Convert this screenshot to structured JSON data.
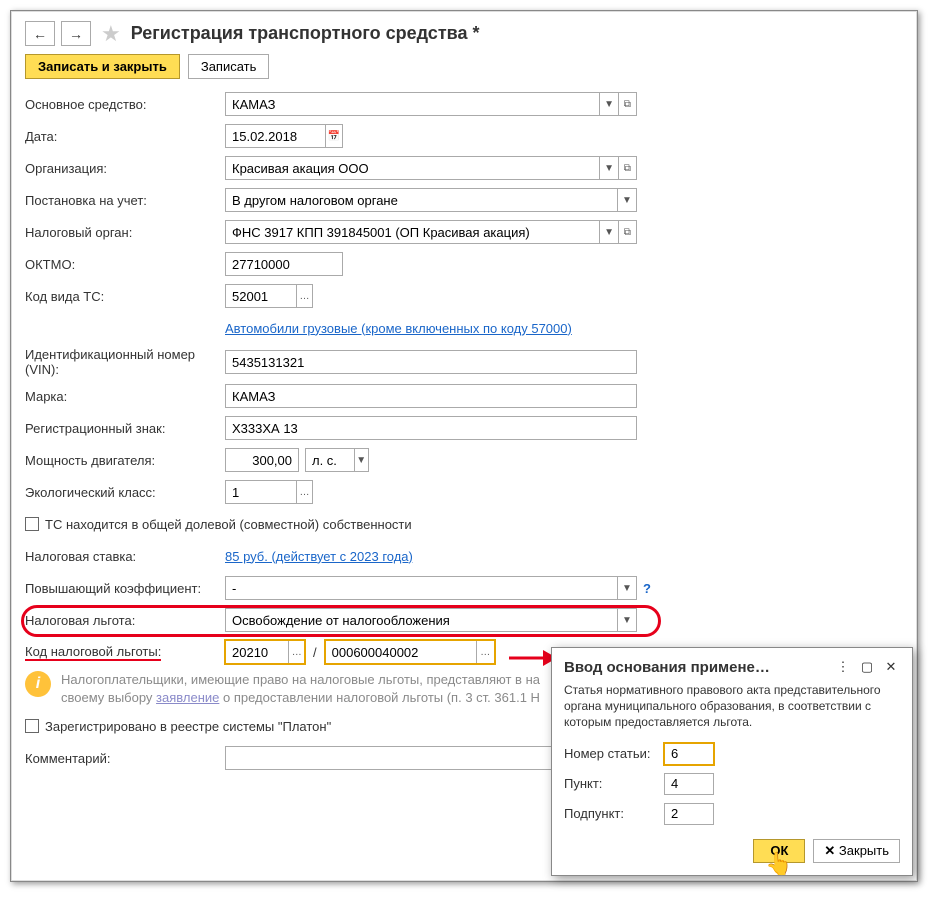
{
  "title": "Регистрация транспортного средства *",
  "toolbar": {
    "save_close": "Записать и закрыть",
    "save": "Записать"
  },
  "labels": {
    "asset": "Основное средство:",
    "date": "Дата:",
    "org": "Организация:",
    "reg": "Постановка на учет:",
    "tax_auth": "Налоговый орган:",
    "oktmo": "ОКТМО:",
    "ts_code": "Код вида ТС:",
    "vin": "Идентификационный номер (VIN):",
    "brand": "Марка:",
    "plate": "Регистрационный знак:",
    "power": "Мощность двигателя:",
    "eco": "Экологический класс:",
    "shared": "ТС находится в общей долевой (совместной) собственности",
    "rate": "Налоговая ставка:",
    "coef": "Повышающий коэффициент:",
    "benefit": "Налоговая льгота:",
    "benefit_code": "Код налоговой льготы:",
    "platon": "Зарегистрировано в реестре системы \"Платон\"",
    "comment": "Комментарий:"
  },
  "values": {
    "asset": "КАМАЗ",
    "date": "15.02.2018",
    "org": "Красивая акация ООО",
    "reg": "В другом налоговом органе",
    "tax_auth": "ФНС 3917 КПП 391845001 (ОП Красивая акация)",
    "oktmo": "27710000",
    "ts_code": "52001",
    "ts_code_desc": "Автомобили грузовые (кроме включенных по коду 57000)",
    "vin": "5435131321",
    "brand": "КАМАЗ",
    "plate": "Х333ХА 13",
    "power": "300,00",
    "power_unit": "л. с.",
    "eco": "1",
    "rate": "85 руб. (действует с 2023 года)",
    "coef": "-",
    "benefit": "Освобождение от налогообложения",
    "benefit_code1": "20210",
    "benefit_code2": "000600040002",
    "hint1": "Налогоплательщики, имеющие право на налоговые льготы, представляют в на",
    "hint2_a": "своему выбору ",
    "hint2_link": "заявление",
    "hint2_b": " о предоставлении налоговой льготы (п. 3 ст. 361.1 Н"
  },
  "popup": {
    "title": "Ввод основания примене…",
    "desc": "Статья нормативного правового акта представительного органа муниципального образования, в соответствии с которым предоставляется льгота.",
    "article_label": "Номер статьи:",
    "article": "6",
    "point_label": "Пункт:",
    "point": "4",
    "subpoint_label": "Подпункт:",
    "subpoint": "2",
    "ok": "ОК",
    "close": "Закрыть"
  }
}
